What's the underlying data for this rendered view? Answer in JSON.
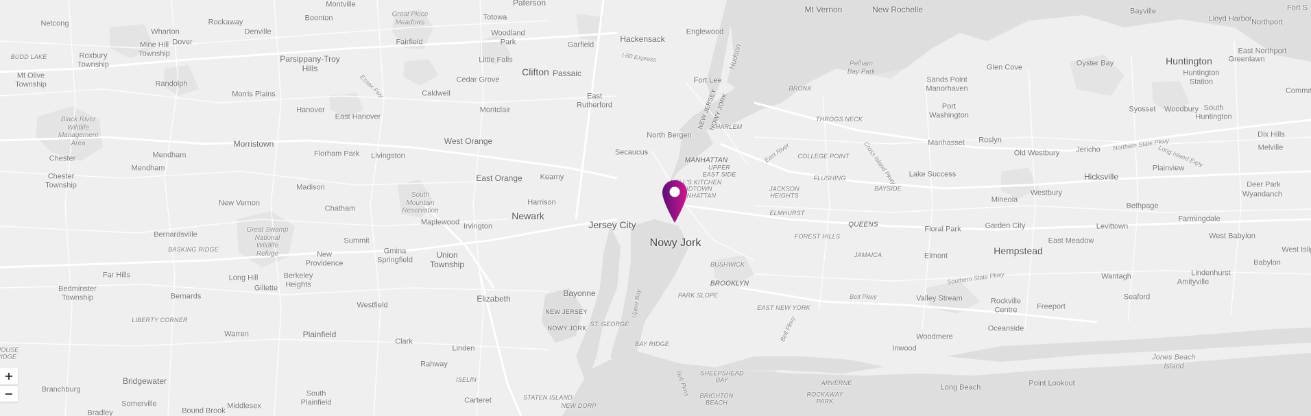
{
  "map": {
    "labels": {
      "paterson": "Paterson",
      "montville": "Montville",
      "boonton": "Boonton",
      "rockaway": "Rockaway",
      "netcong": "Netcong",
      "wharton": "Wharton",
      "denville": "Denville",
      "great_piece_meadows": "Great Piece\nMeadows",
      "totowa": "Totowa",
      "woodland_park": "Woodland\nPark",
      "fairfield": "Fairfield",
      "garfield": "Garfield",
      "hackensack": "Hackensack",
      "englewood": "Englewood",
      "mt_vernon": "Mt Vernon",
      "new_rochelle": "New Rochelle",
      "bayville": "Bayville",
      "lloyd_harbor": "Lloyd Harbor",
      "fort_salonga": "Fort S",
      "northport": "Northport",
      "east_northport": "East Northport",
      "mine_hill": "Mine Hill\nTownship",
      "dover": "Dover",
      "budd_lake": "BUDD LAKE",
      "roxbury": "Roxbury\nTownship",
      "parsippany": "Parsippany-Troy\nHills",
      "little_falls": "Little Falls",
      "i80_express": "I-80 Express",
      "hudson": "Hudson",
      "glen_cove": "Glen Cove",
      "oyster_bay": "Oyster Bay",
      "huntington": "Huntington",
      "greenlawn": "Greenlawn",
      "mt_olive": "Mt Olive\nTownship",
      "randolph": "Randolph",
      "essex_fwy": "Essex Fwy",
      "clifton": "Clifton",
      "passaic": "Passaic",
      "cedar_grove": "Cedar Grove",
      "fort_lee": "Fort Lee",
      "pelham_bay_park": "Pelham\nBay Park",
      "sands_point": "Sands Point",
      "manorhaven": "Manorhaven",
      "huntington_station": "Huntington\nStation",
      "commack": "Commac",
      "morris_plains": "Morris Plains",
      "caldwell": "Caldwell",
      "east_rutherford": "East\nRutherford",
      "bronx": "BRONX",
      "new_jersey_vert": "NEW JERSEY",
      "nowy_jork_vert": "NOWY JORK",
      "port_washington": "Port\nWashington",
      "syosset": "Syosset",
      "woodbury": "Woodbury",
      "south_huntington": "South\nHuntington",
      "black_river": "Black River\nWildlife\nManagement\nArea",
      "hanover": "Hanover",
      "montclair": "Montclair",
      "east_hanover": "East Hanover",
      "throgs_neck": "THROGS NECK",
      "harlem": "HARLEM",
      "north_bergen": "North Bergen",
      "roslyn": "Roslyn",
      "manhasset": "Manhasset",
      "jericho": "Jericho",
      "northern_state_pkwy": "Northern State Pkwy",
      "dix_hills": "Dix Hills",
      "morristown": "Morristown",
      "west_orange": "West Orange",
      "secaucus": "Secaucus",
      "east_river": "East River",
      "college_point": "COLLEGE POINT",
      "cross_island_pkwy": "Cross Island Pkwy",
      "old_westbury": "Old Westbury",
      "long_island_expy": "Long Island Expy",
      "melville": "Melville",
      "chester": "Chester",
      "mendham_tw": "Mendham",
      "florham_park": "Florham Park",
      "livingston": "Livingston",
      "manhattan": "MANHATTAN",
      "mendham": "Mendham",
      "upper_east_side": "UPPER\nEAST SIDE",
      "flushing": "FLUSHING",
      "lake_success": "Lake Success",
      "hicksville": "Hicksville",
      "plainview": "Plainview",
      "chester_tw": "Chester\nTownship",
      "madison": "Madison",
      "east_orange": "East Orange",
      "kearny": "Kearny",
      "hells_kitchen": "HELL'S KITCHEN",
      "midtown": "MIDTOWN\nMANHATTAN",
      "jackson_heights": "JACKSON\nHEIGHTS",
      "bayside": "BAYSIDE",
      "westbury": "Westbury",
      "deer_park": "Deer Park",
      "wyandanch": "Wyandanch",
      "new_vernon": "New Vernon",
      "south_mountain": "South\nMountain\nReservation",
      "harrison": "Harrison",
      "chatham": "Chatham",
      "mineola": "Mineola",
      "bethpage": "Bethpage",
      "elmhurst": "ELMHURST",
      "newark": "Newark",
      "maplewood": "Maplewood",
      "irvington": "Irvington",
      "jersey_city": "Jersey City",
      "queens": "QUEENS",
      "floral_park": "Floral Park",
      "garden_city": "Garden City",
      "levittown": "Levittown",
      "farmingdale": "Farmingdale",
      "bernardsville": "Bernardsville",
      "great_swamp": "Great Swamp\nNational\nWildlife\nRefuge",
      "summit": "Summit",
      "forest_hills": "FOREST HILLS",
      "east_meadow": "East Meadow",
      "west_babylon": "West Babylon",
      "west_islip": "West Islip",
      "basking_ridge": "BASKING RIDGE",
      "new_providence": "New\nProvidence",
      "gmina_springfield": "Gmina\nSpringfield",
      "union_township": "Union\nTownship",
      "nowy_jork": "Nowy Jork",
      "jamaica": "JAMAICA",
      "hempstead": "Hempstead",
      "elmont": "Elmont",
      "babylon": "Babylon",
      "far_hills": "Far Hills",
      "long_hill": "Long Hill",
      "berkeley_heights": "Berkeley\nHeights",
      "gillette": "Gillette",
      "bushwick": "BUSHWICK",
      "southern_state_pkwy": "Southern State Pkwy",
      "wantagh": "Wantagh",
      "lindenhurst": "Lindenhurst",
      "amityville": "Amityville",
      "bedminster": "Bedminster\nTownship",
      "bernards": "Bernards",
      "brooklyn": "BROOKLYN",
      "elizabeth": "Elizabeth",
      "bayonne": "Bayonne",
      "belt_pkwy": "Belt Pkwy",
      "valley_stream": "Valley Stream",
      "rockville_centre": "Rockville\nCentre",
      "seaford": "Seaford",
      "park_slope": "PARK SLOPE",
      "upper_bay": "Upper Bay",
      "westfield": "Westfield",
      "liberty_corner": "LIBERTY CORNER",
      "new_jersey": "NEW JERSEY",
      "nowy_jork_caps": "NOWY JORK",
      "st_george": "ST. GEORGE",
      "east_new_york": "EAST NEW YORK",
      "freeport": "Freeport",
      "belt_pkwy2": "Belt Pkwy",
      "warren": "Warren",
      "plainfield": "Plainfield",
      "oceanside": "Oceanside",
      "clark": "Clark",
      "bay_ridge": "BAY RIDGE",
      "woodmere": "Woodmere",
      "linden": "Linden",
      "inwood": "Inwood",
      "rahway": "Rahway",
      "jones_beach": "Jones Beach\nIsland",
      "house_bridge": "HOUSE\nRIDGE",
      "bridgewater": "Bridgewater",
      "branchburg": "Branchburg",
      "iselin": "ISELIN",
      "belt_pkwy3": "Belt Pkwy",
      "sheepshead_bay": "SHEEPSHEAD\nBAY",
      "arverne": "ARVERNE",
      "long_beach": "Long Beach",
      "point_lookout": "Point Lookout",
      "somerville": "Somerville",
      "south_plainfield": "South\nPlainfield",
      "carteret": "Carteret",
      "staten_island": "STATEN ISLAND",
      "brighton_beach": "BRIGHTON\nBEACH",
      "rockaway_park": "ROCKAWAY\nPARK",
      "bound_brook": "Bound Brook",
      "middlesex": "Middlesex",
      "new_dorp": "NEW DORP",
      "bradley": "Bradley"
    },
    "zoom": {
      "in_label": "+",
      "out_label": "−"
    },
    "marker": {
      "gradient_start": "#5b0f7a",
      "gradient_end": "#d3158f"
    }
  }
}
